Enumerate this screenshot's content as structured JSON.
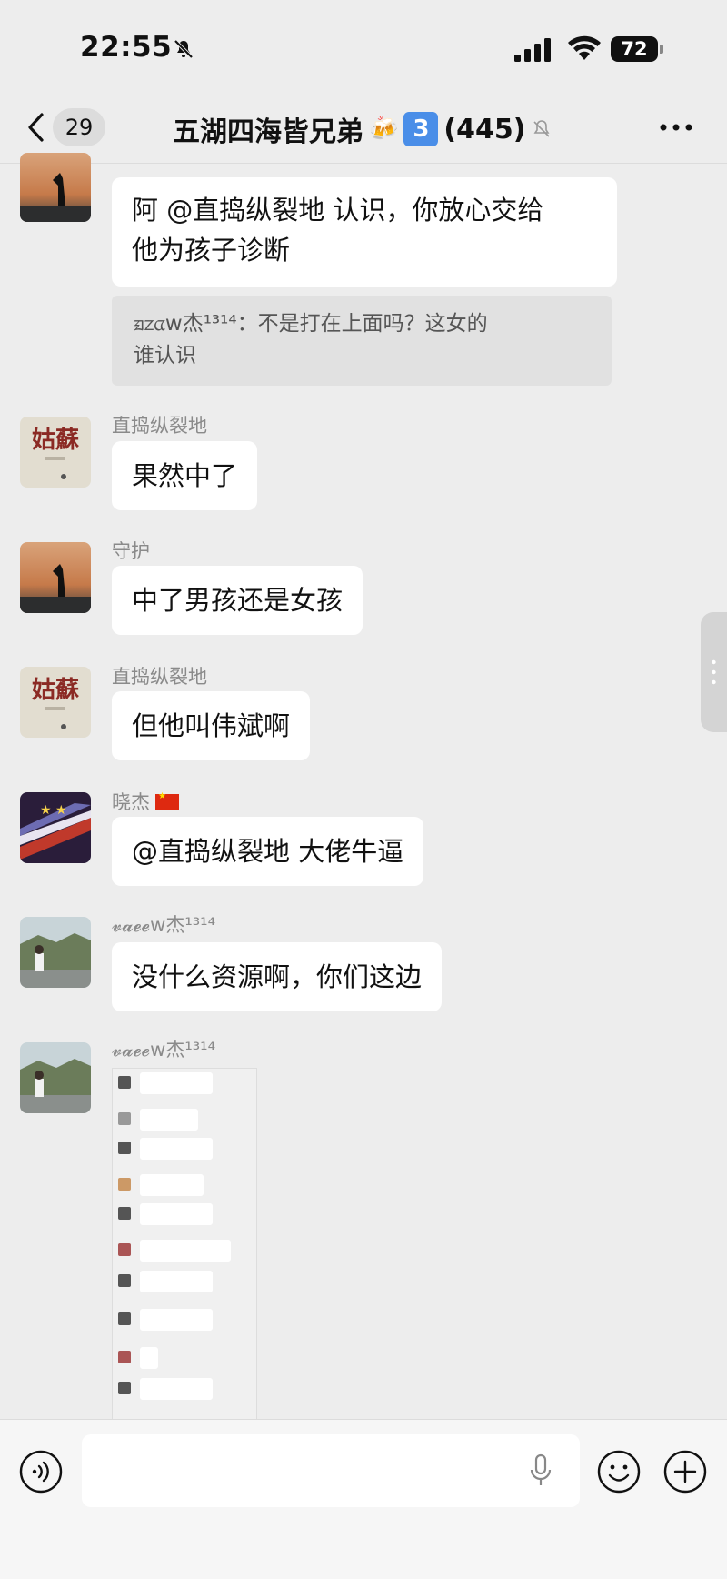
{
  "status_bar": {
    "time": "22:55",
    "battery": "72"
  },
  "nav": {
    "back_count": "29",
    "title": "五湖四海皆兄弟",
    "badge_number": "3",
    "member_count": "(445)"
  },
  "messages": [
    {
      "sender": "",
      "text_line1": "阿 @直捣纵裂地 认识，你放心交给",
      "text_line2": "他为孩子诊断",
      "quote_line1": "ᤀᤁᤂw杰¹³¹⁴：不是打在上面吗？这女的",
      "quote_line2": "谁认识"
    },
    {
      "sender": "直捣纵裂地",
      "text": "果然中了"
    },
    {
      "sender": "守护",
      "text": "中了男孩还是女孩"
    },
    {
      "sender": "直捣纵裂地",
      "text": "但他叫伟斌啊"
    },
    {
      "sender": "晓杰",
      "text": "@直捣纵裂地 大佬牛逼"
    },
    {
      "sender": "𝓿𝓪𝓮𝓮w杰¹³¹⁴",
      "text": "没什么资源啊，你们这边"
    },
    {
      "sender": "𝓿𝓪𝓮𝓮w杰¹³¹⁴",
      "image": "screenshot-thumbnail"
    }
  ],
  "avatars": {
    "gusu_text": "姑蘇"
  },
  "icons": [
    "mute-icon",
    "signal-icon",
    "wifi-icon",
    "back-chevron-icon",
    "beer-icon",
    "bell-off-icon",
    "more-icon",
    "voice-icon",
    "mic-icon",
    "emoji-icon",
    "plus-icon"
  ],
  "colors": {
    "background": "#ededed",
    "bubble": "#ffffff",
    "badge": "#4a8ee8"
  }
}
